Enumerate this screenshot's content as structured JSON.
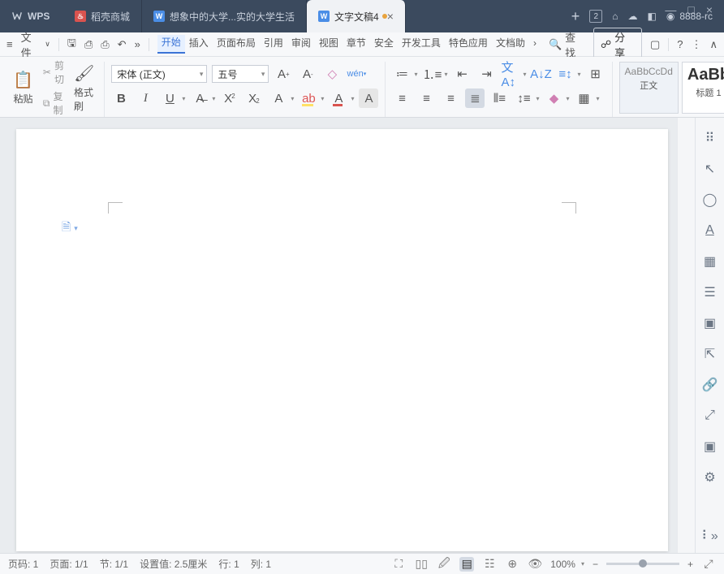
{
  "titlebar": {
    "app": "WPS",
    "tabs": [
      {
        "label": "稻壳商城",
        "icon": "red"
      },
      {
        "label": "想象中的大学...实的大学生活",
        "icon": "blue"
      },
      {
        "label": "文字文稿4",
        "icon": "blue",
        "active": true,
        "dirty": true
      }
    ],
    "new_tab": "+",
    "square_count": "2",
    "user": "8888-rc"
  },
  "quickbar": {
    "file_label": "文件",
    "menu_tabs": [
      "开始",
      "插入",
      "页面布局",
      "引用",
      "审阅",
      "视图",
      "章节",
      "安全",
      "开发工具",
      "特色应用",
      "文档助"
    ],
    "active_index": 0,
    "search": "查找",
    "share": "分享"
  },
  "ribbon": {
    "clipboard": {
      "paste": "粘贴",
      "cut": "剪切",
      "copy": "复制",
      "format_painter": "格式刷"
    },
    "font": {
      "name": "宋体 (正文)",
      "size": "五号"
    },
    "styles": {
      "normal_preview": "AaBbCcDd",
      "normal_label": "正文",
      "heading_preview": "AaBb",
      "heading_label": "标题 1"
    }
  },
  "statusbar": {
    "page_no": "页码: 1",
    "page_of": "页面: 1/1",
    "section": "节: 1/1",
    "setting": "设置值: 2.5厘米",
    "line": "行: 1",
    "col": "列: 1",
    "zoom": "100%"
  }
}
